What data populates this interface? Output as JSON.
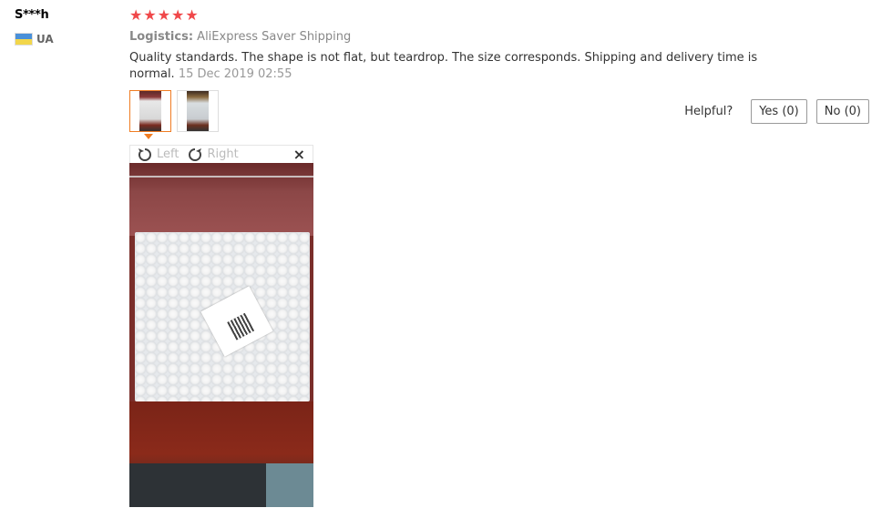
{
  "user": {
    "name": "S***h",
    "country": "UA"
  },
  "review": {
    "rating_stars": 5,
    "stars": [
      "★",
      "★",
      "★",
      "★",
      "★"
    ],
    "logistics_label": "Logistics:",
    "logistics_value": "AliExpress Saver Shipping",
    "text": "Quality standards. The shape is not flat, but teardrop. The size corresponds. Shipping and delivery time is normal.",
    "date": "15 Dec 2019 02:55"
  },
  "viewer": {
    "rotate_left": "Left",
    "rotate_right": "Right",
    "close": "×"
  },
  "helpful": {
    "label": "Helpful?",
    "yes": "Yes (0)",
    "no": "No (0)"
  },
  "colors": {
    "star": "#f0484a",
    "thumb_active": "#f07c22"
  }
}
